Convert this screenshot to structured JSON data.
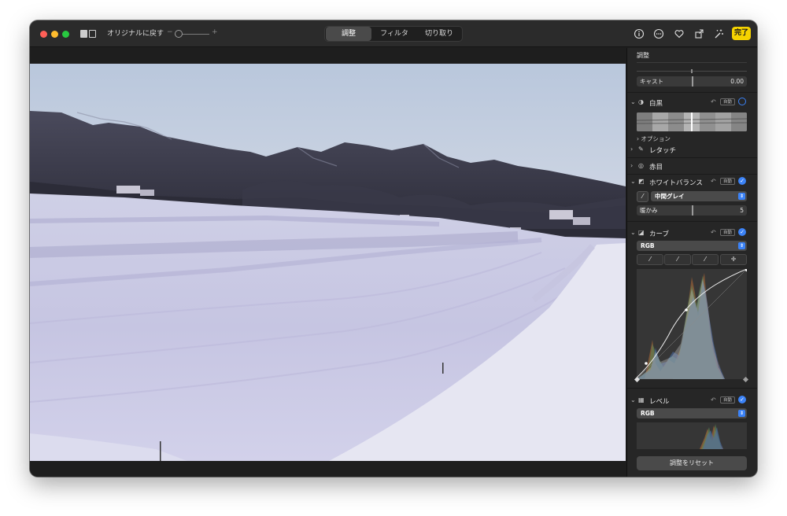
{
  "toolbar": {
    "revert_label": "オリジナルに戻す",
    "zoom_minus": "−",
    "zoom_plus": "+",
    "tabs": [
      "調整",
      "フィルタ",
      "切り取り"
    ],
    "active_tab": "調整",
    "done_label": "完了",
    "icons": [
      "info-icon",
      "more-icon",
      "heart-icon",
      "share-icon",
      "magic-wand-icon"
    ]
  },
  "panel": {
    "heading": "調整",
    "cast": {
      "label": "キャスト",
      "value": "0.00"
    },
    "black_white": {
      "title": "白黒",
      "auto": "自動",
      "option": "オプション"
    },
    "retouch": {
      "title": "レタッチ"
    },
    "red_eye": {
      "title": "赤目"
    },
    "white_balance": {
      "title": "ホワイトバランス",
      "auto": "自動",
      "mode": "中間グレイ",
      "warmth_label": "暖かみ",
      "warmth_value": "5"
    },
    "curves": {
      "title": "カーブ",
      "auto": "自動",
      "channel": "RGB"
    },
    "levels": {
      "title": "レベル",
      "auto": "自動",
      "channel": "RGB"
    },
    "reset_label": "調整をリセット"
  },
  "colors": {
    "accent": "#3b82f6",
    "done": "#f5d300"
  }
}
